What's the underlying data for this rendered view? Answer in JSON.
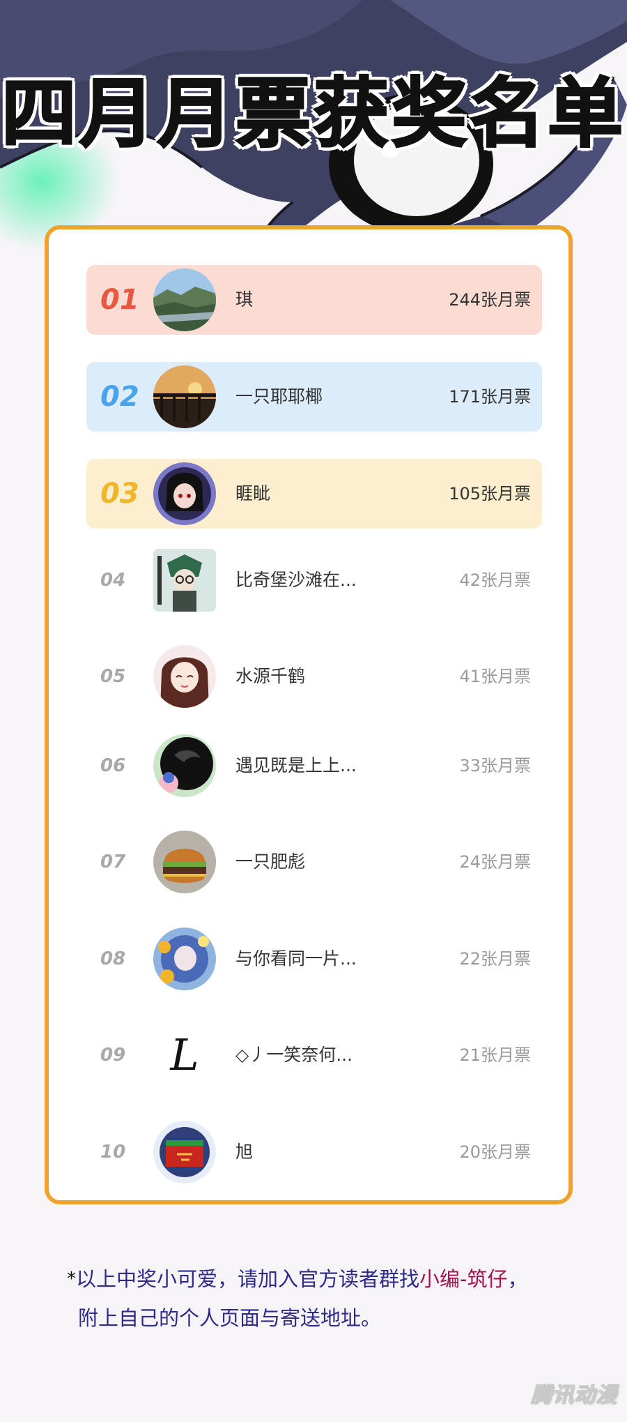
{
  "title": "四月月票获奖名单",
  "colors": {
    "card_border": "#eda32c",
    "rank1_bg": "#fbdcd3",
    "rank1_num": "#e8573f",
    "rank2_bg": "#dcecfa",
    "rank2_num": "#4aa3e8",
    "rank3_bg": "#fcefcf",
    "rank3_num": "#f0b62a",
    "note_text": "#2e2a8c",
    "note_highlight": "#a01550"
  },
  "ranking": [
    {
      "rank": "01",
      "name": "琪",
      "votes": "244张月票",
      "avatar_icon": "landscape-avatar-icon"
    },
    {
      "rank": "02",
      "name": "一只耶耶椰",
      "votes": "171张月票",
      "avatar_icon": "sunset-avatar-icon"
    },
    {
      "rank": "03",
      "name": "睚眦",
      "votes": "105张月票",
      "avatar_icon": "anime-girl-avatar-icon"
    },
    {
      "rank": "04",
      "name": "比奇堡沙滩在...",
      "votes": "42张月票",
      "avatar_icon": "anime-character-avatar-icon"
    },
    {
      "rank": "05",
      "name": "水源千鹤",
      "votes": "41张月票",
      "avatar_icon": "anime-girl-avatar-icon"
    },
    {
      "rank": "06",
      "name": "遇见既是上上...",
      "votes": "33张月票",
      "avatar_icon": "dark-cat-avatar-icon"
    },
    {
      "rank": "07",
      "name": "一只肥彪",
      "votes": "24张月票",
      "avatar_icon": "burger-avatar-icon"
    },
    {
      "rank": "08",
      "name": "与你看同一片...",
      "votes": "22张月票",
      "avatar_icon": "flower-girl-avatar-icon"
    },
    {
      "rank": "09",
      "name": "◇丿一笑奈何...",
      "votes": "21张月票",
      "avatar_icon": "letter-l-avatar-icon"
    },
    {
      "rank": "10",
      "name": "旭",
      "votes": "20张月票",
      "avatar_icon": "red-emblem-avatar-icon"
    }
  ],
  "note": {
    "star": "*",
    "line1_before": "以上中奖小可爱，请加入官方读者群找",
    "line1_highlight": "小编-筑仔",
    "line1_after": "，",
    "line2": "附上自己的个人页面与寄送地址。"
  },
  "watermark": "腾讯动漫"
}
